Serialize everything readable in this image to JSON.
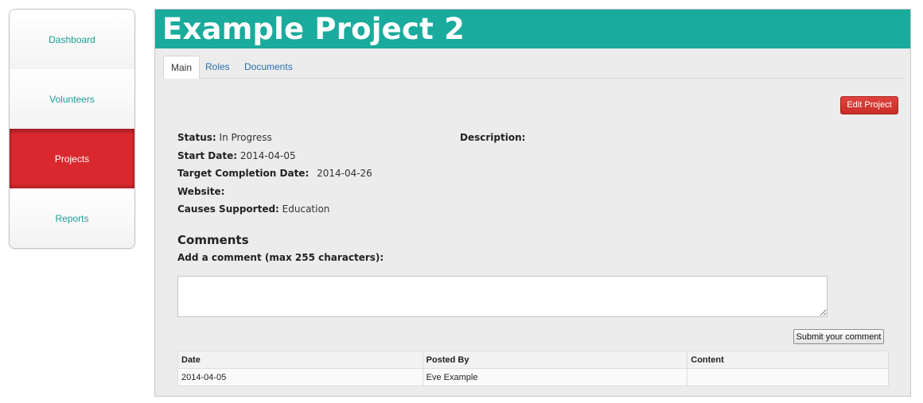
{
  "sidebar": {
    "items": [
      {
        "label": "Dashboard"
      },
      {
        "label": "Volunteers"
      },
      {
        "label": "Projects"
      },
      {
        "label": "Reports"
      }
    ]
  },
  "header": {
    "title": "Example Project 2"
  },
  "tabs": [
    {
      "label": "Main"
    },
    {
      "label": "Roles"
    },
    {
      "label": "Documents"
    }
  ],
  "actions": {
    "edit_label": "Edit Project"
  },
  "details": {
    "status_label": "Status:",
    "status_value": "In Progress",
    "start_label": "Start Date:",
    "start_value": "2014-04-05",
    "target_label": "Target Completion Date:",
    "target_value": "2014-04-26",
    "website_label": "Website:",
    "website_value": "",
    "causes_label": "Causes Supported:",
    "causes_value": "Education",
    "description_label": "Description:"
  },
  "comments": {
    "heading": "Comments",
    "add_label": "Add a comment (max 255 characters):",
    "input_value": "",
    "submit_label": "Submit your comment",
    "columns": [
      "Date",
      "Posted By",
      "Content"
    ],
    "rows": [
      {
        "date": "2014-04-05",
        "posted_by": "Eve Example",
        "content": ""
      }
    ]
  },
  "colors": {
    "accent_teal": "#1aab9c",
    "active_red": "#d9292f",
    "link_blue": "#2a6fae"
  }
}
